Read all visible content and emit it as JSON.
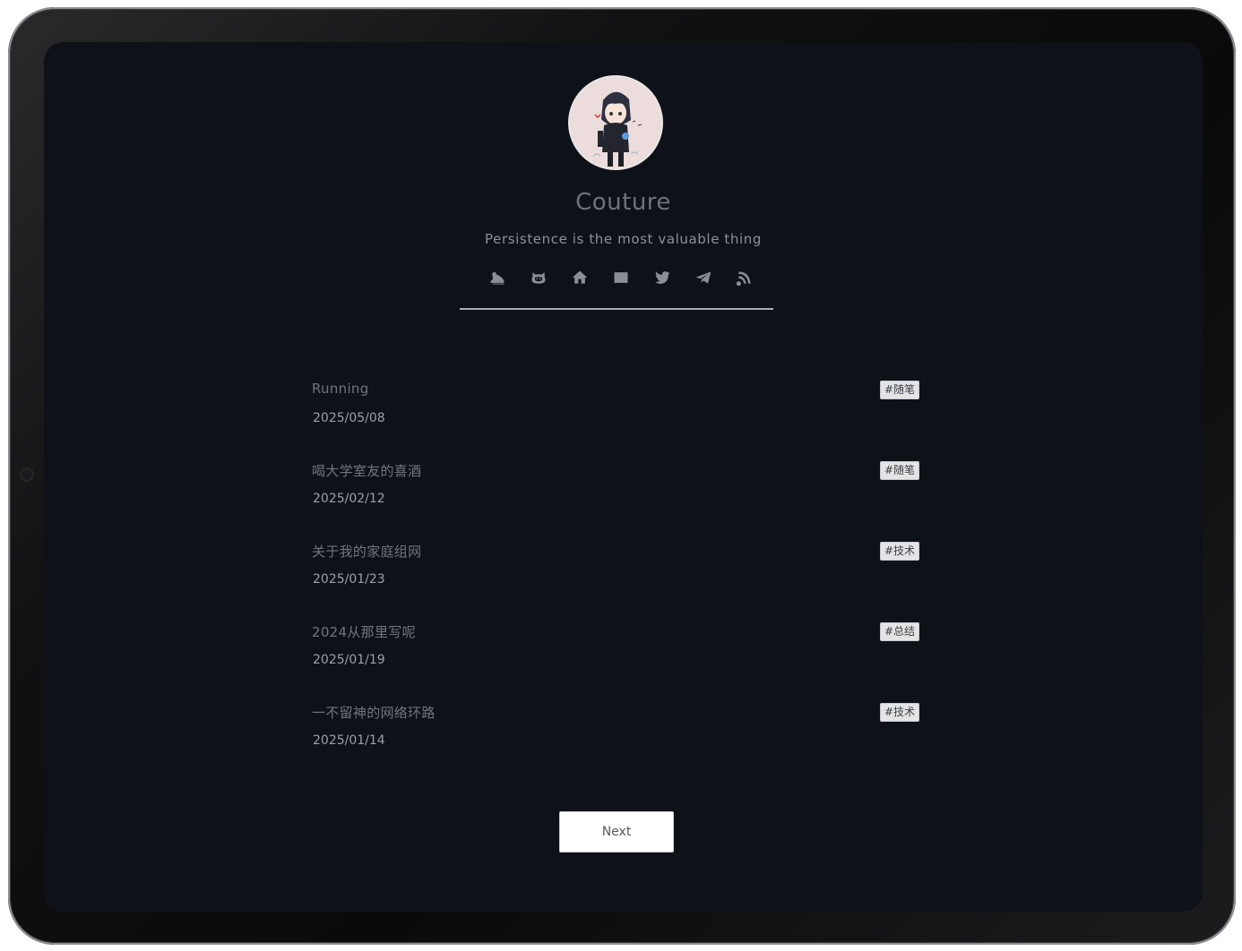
{
  "profile": {
    "name": "Couture",
    "motto": "Persistence is the most valuable thing"
  },
  "social_icons": [
    {
      "name": "sneaker-icon"
    },
    {
      "name": "github-icon"
    },
    {
      "name": "home-icon"
    },
    {
      "name": "mail-icon"
    },
    {
      "name": "twitter-icon"
    },
    {
      "name": "telegram-icon"
    },
    {
      "name": "rss-icon"
    }
  ],
  "posts": [
    {
      "title": "Running",
      "date": "2025/05/08",
      "tag": "#随笔"
    },
    {
      "title": "喝大学室友的喜酒",
      "date": "2025/02/12",
      "tag": "#随笔"
    },
    {
      "title": "关于我的家庭组网",
      "date": "2025/01/23",
      "tag": "#技术"
    },
    {
      "title": "2024从那里写呢",
      "date": "2025/01/19",
      "tag": "#总结"
    },
    {
      "title": "一不留神的网络环路",
      "date": "2025/01/14",
      "tag": "#技术"
    }
  ],
  "pagination": {
    "next_label": "Next"
  },
  "colors": {
    "background": "#0e1118",
    "title": "#6c737b",
    "text": "#9aa0a6",
    "tag_bg": "#e4e4e6"
  }
}
